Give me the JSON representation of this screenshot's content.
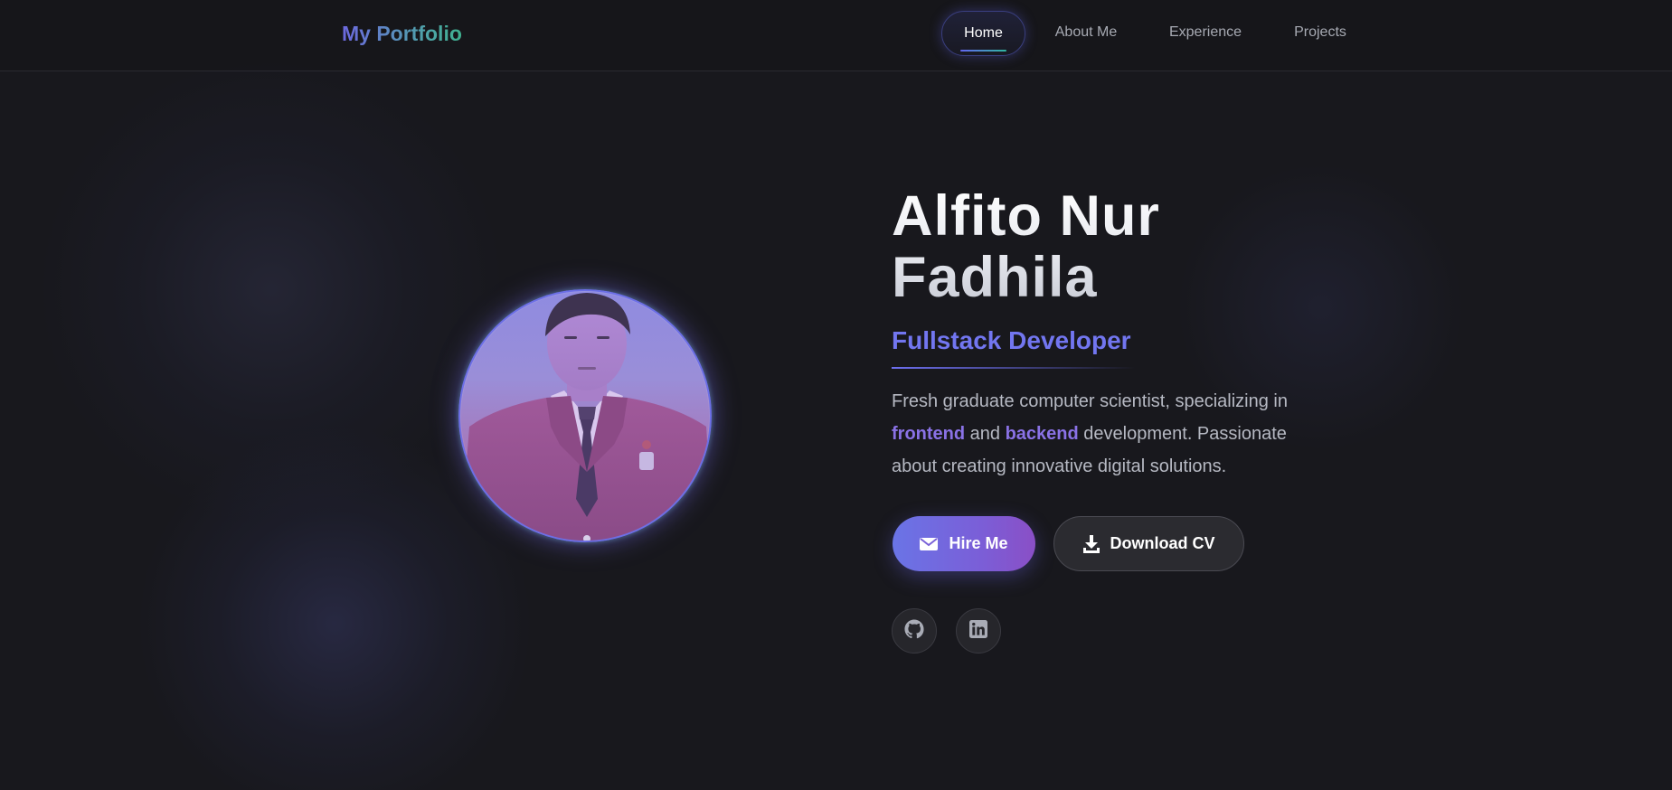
{
  "navbar": {
    "brand": "My Portfolio",
    "items": [
      {
        "label": "Home",
        "active": true
      },
      {
        "label": "About Me",
        "active": false
      },
      {
        "label": "Experience",
        "active": false
      },
      {
        "label": "Projects",
        "active": false
      }
    ]
  },
  "hero": {
    "name_line1": "Alfito Nur",
    "name_line2": "Fadhila",
    "role": "Fullstack Developer",
    "description": {
      "part1": "Fresh graduate computer scientist, specializing in ",
      "highlight1": "frontend",
      "part2": " and ",
      "highlight2": "backend",
      "part3": " development. Passionate about creating innovative digital solutions."
    },
    "buttons": {
      "hire": {
        "label": "Hire Me",
        "icon": "envelope-icon"
      },
      "cv": {
        "label": "Download CV",
        "icon": "download-icon"
      }
    },
    "socials": [
      {
        "name": "GitHub",
        "icon": "github-icon"
      },
      {
        "name": "LinkedIn",
        "icon": "linkedin-icon"
      }
    ],
    "avatar_icon": "profile-photo"
  },
  "colors": {
    "background": "#18181d",
    "accent": "#6366f1",
    "accent_purple": "#8a72e6",
    "accent_teal": "#2fb6a0"
  }
}
